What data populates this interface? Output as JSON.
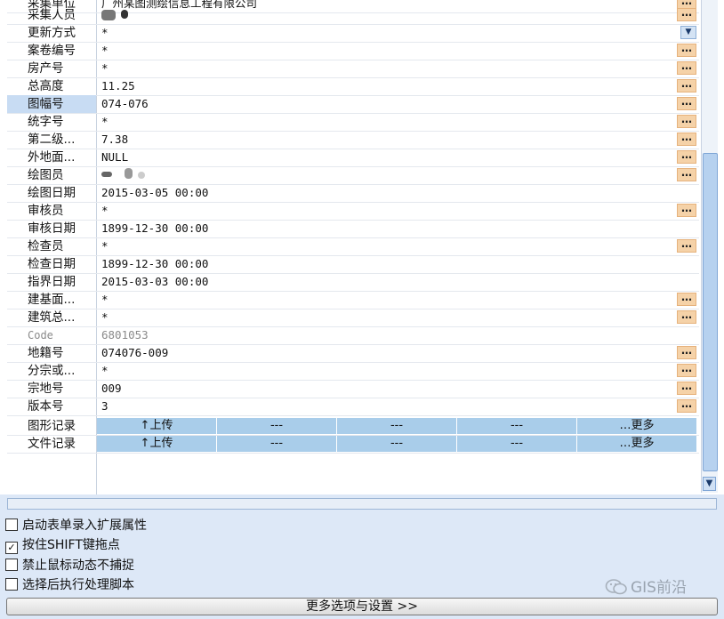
{
  "rows": [
    {
      "label": "采集单位",
      "value": "广州某图测绘信息工程有限公司",
      "btn": "…"
    },
    {
      "label": "采集人员",
      "value": "",
      "btn": "…"
    },
    {
      "label": "更新方式",
      "value": "*",
      "dropdown": "▼"
    },
    {
      "label": "案卷编号",
      "value": "*",
      "btn": "…"
    },
    {
      "label": "房产号",
      "value": "*",
      "btn": "…"
    },
    {
      "label": "总高度",
      "value": "11.25",
      "btn": "…"
    },
    {
      "label": "图幅号",
      "value": "074-076",
      "btn": "…"
    },
    {
      "label": "统字号",
      "value": "*",
      "btn": "…"
    },
    {
      "label": "第二级...",
      "value": "7.38",
      "btn": "…"
    },
    {
      "label": "外地面...",
      "value": "NULL",
      "btn": "…"
    },
    {
      "label": "绘图员",
      "value": "",
      "btn": "…"
    },
    {
      "label": "绘图日期",
      "value": "2015-03-05 00:00"
    },
    {
      "label": "审核员",
      "value": "*",
      "btn": "…"
    },
    {
      "label": "审核日期",
      "value": "1899-12-30 00:00"
    },
    {
      "label": "检查员",
      "value": "*",
      "btn": "…"
    },
    {
      "label": "检查日期",
      "value": "1899-12-30 00:00"
    },
    {
      "label": "指界日期",
      "value": "2015-03-03 00:00"
    },
    {
      "label": "建基面...",
      "value": "*",
      "btn": "…"
    },
    {
      "label": "建筑总...",
      "value": "*",
      "btn": "…"
    },
    {
      "label": "Code",
      "value": "6801053"
    },
    {
      "label": "地籍号",
      "value": "074076-009",
      "btn": "…"
    },
    {
      "label": "分宗或...",
      "value": "*",
      "btn": "…"
    },
    {
      "label": "宗地号",
      "value": "009",
      "btn": "…"
    },
    {
      "label": "版本号",
      "value": "3",
      "btn": "…"
    }
  ],
  "action_rows": [
    {
      "label": "图形记录",
      "upload": "↑上传",
      "dash1": "---",
      "dash2": "---",
      "dash3": "---",
      "more": "…更多"
    },
    {
      "label": "文件记录",
      "upload": "↑上传",
      "dash1": "---",
      "dash2": "---",
      "dash3": "---",
      "more": "…更多"
    }
  ],
  "options": [
    {
      "label": "启动表单录入扩展属性",
      "checked": false,
      "mark": ""
    },
    {
      "label": "按住SHIFT键拖点",
      "checked": true,
      "mark": "✓"
    },
    {
      "label": "禁止鼠标动态不捕捉",
      "checked": false,
      "mark": ""
    },
    {
      "label": "选择后执行处理脚本",
      "checked": false,
      "mark": ""
    }
  ],
  "more_button": "更多选项与设置 >>",
  "watermark": "GIS前沿",
  "colors": {
    "selected_label": "#c8dcf3",
    "dots_button": "#f5d2a8",
    "action_cell": "#a9cdea",
    "panel_bg": "#dde8f7"
  },
  "icons": {
    "dots": "ellipsis-icon",
    "dropdown": "chevron-down-icon",
    "check": "checkmark-icon",
    "watermark": "wechat-logo-icon"
  }
}
